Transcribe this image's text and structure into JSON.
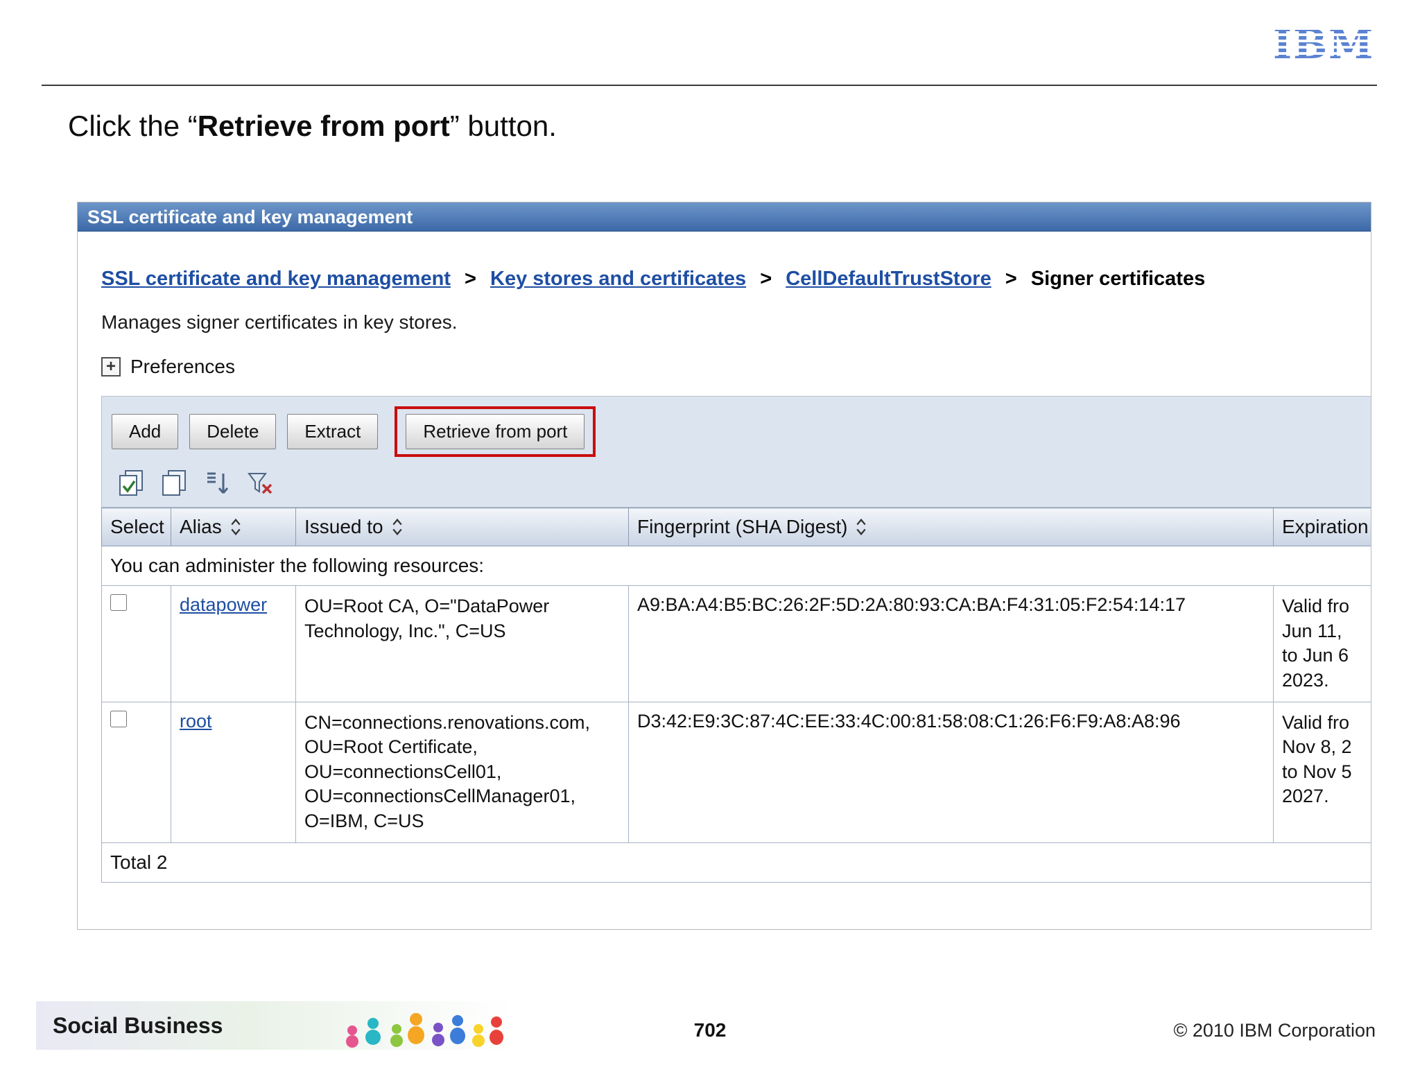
{
  "page": {
    "title": {
      "prefix": "Click the “",
      "bold": "Retrieve from port",
      "suffix": "” button."
    },
    "logo_text": "IBM",
    "footer": {
      "brand": "Social Business",
      "page_number": "702",
      "copyright": "© 2010 IBM Corporation"
    }
  },
  "console": {
    "title": "SSL certificate and key management",
    "breadcrumb": {
      "items": [
        "SSL certificate and key management",
        "Key stores and certificates",
        "CellDefaultTrustStore",
        "Signer certificates"
      ],
      "separator": ">"
    },
    "description": "Manages signer certificates in key stores.",
    "preferences": {
      "label": "Preferences",
      "expand_glyph": "+"
    },
    "toolbar": {
      "buttons": [
        "Add",
        "Delete",
        "Extract",
        "Retrieve from port"
      ],
      "icon_names": [
        "select-all",
        "deselect-all",
        "show-filter",
        "clear-filter"
      ],
      "highlight_color": "#c90d0d"
    },
    "table": {
      "headers": {
        "select": "Select",
        "alias": "Alias",
        "issued_to": "Issued to",
        "fingerprint": "Fingerprint (SHA Digest)",
        "expiration": "Expiration"
      },
      "admin_note": "You can administer the following resources:",
      "rows": [
        {
          "alias": "datapower",
          "issued_to": "OU=Root CA, O=\"DataPower\nTechnology, Inc.\", C=US",
          "fingerprint": "A9:BA:A4:B5:BC:26:2F:5D:2A:80:93:CA:BA:F4:31:05:F2:54:14:17",
          "expiration": "Valid fro\nJun 11,\nto Jun 6\n2023."
        },
        {
          "alias": "root",
          "issued_to": "CN=connections.renovations.com,\nOU=Root Certificate,\nOU=connectionsCell01,\nOU=connectionsCellManager01,\nO=IBM, C=US",
          "fingerprint": "D3:42:E9:3C:87:4C:EE:33:4C:00:81:58:08:C1:26:F6:F9:A8:A8:96",
          "expiration": "Valid fro\nNov 8, 2\nto Nov 5\n2027."
        }
      ],
      "total": "Total 2"
    }
  }
}
